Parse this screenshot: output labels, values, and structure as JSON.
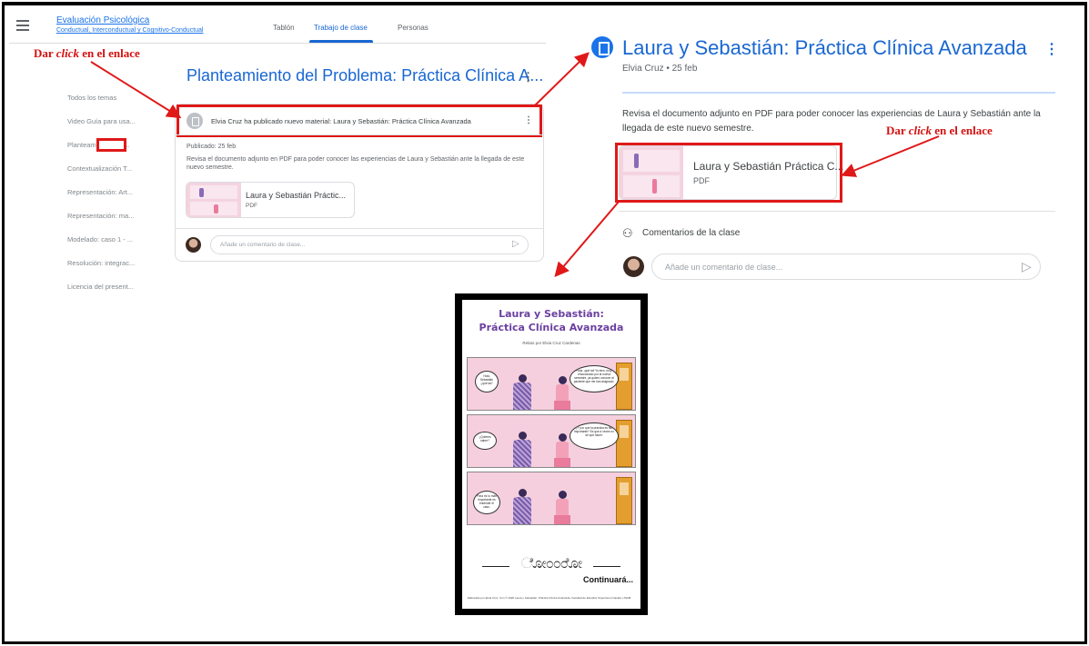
{
  "classroom": {
    "course_title": "Evaluación Psicológica",
    "course_subtitle": "Conductual, Interconductual y Cognitivo-Conductual",
    "tabs": [
      {
        "label": "Tablón",
        "active": false
      },
      {
        "label": "Trabajo de clase",
        "active": true
      },
      {
        "label": "Personas",
        "active": false
      }
    ],
    "accent_color": "#1967d2"
  },
  "sidebar": {
    "topics": [
      "Todos los temas",
      "Video Guía para usa...",
      "Planteamiento del ...",
      "Contextualización T...",
      "Representación: Art...",
      "Representación: ma...",
      "Modelado: caso 1 - ...",
      "Resolución: integrac...",
      "Licencia del present..."
    ]
  },
  "left_panel": {
    "topic_title": "Planteamiento del Problema: Práctica Clínica A...",
    "post_text": "Elvia Cruz ha publicado nuevo material: Laura y Sebastián: Práctica Clínica Avanzada",
    "published": "Publicado: 25 feb",
    "description": "Revisa el documento adjunto en PDF para poder conocer las experiencias de Laura y Sebastián ante la llegada de este nuevo semestre.",
    "attachment_name": "Laura y Sebastián Práctic...",
    "attachment_type": "PDF",
    "comment_placeholder": "Añade un comentario de clase..."
  },
  "right_panel": {
    "title": "Laura y Sebastián: Práctica Clínica Avanzada",
    "author_date": "Elvia Cruz • 25 feb",
    "description": "Revisa el documento adjunto en PDF para poder conocer las experiencias de Laura y Sebastián ante la llegada de este nuevo semestre.",
    "attachment_name": "Laura y Sebastián Práctica C...",
    "attachment_type": "PDF",
    "comments_heading": "Comentarios de la clase",
    "comment_placeholder": "Añade un comentario de clase..."
  },
  "annotations": {
    "label_prefix": "Dar ",
    "label_italic": "click",
    "label_suffix": " en el enlace",
    "highlight_color": "#e01818"
  },
  "comic": {
    "title_line1": "Laura y Sebastián:",
    "title_line2": "Práctica Clínica Avanzada",
    "credit": "Relato por Elvia Cruz Cardenas",
    "bubbles": [
      "Hola, Sebastián ¿qué tal?",
      "Hola, ¡qué tal! Yo bien, muy emocionado por la nueva semestre, ya quiero conocer al paciente que me han asignado.",
      "¿Y por qué la práctica es tan importante? Es que a veces no sé qué hacer.",
      "¿Quieres saber?",
      "Para mí lo más importante es entender el caso."
    ],
    "ending": "Continuará...",
    "footer": "Elaborado por Elvia Cruz. Con © 2020 Laura y Sebastián: Práctica Clínica Avanzada. Facultad de Estudios Superiores Iztacala, UNAM."
  }
}
